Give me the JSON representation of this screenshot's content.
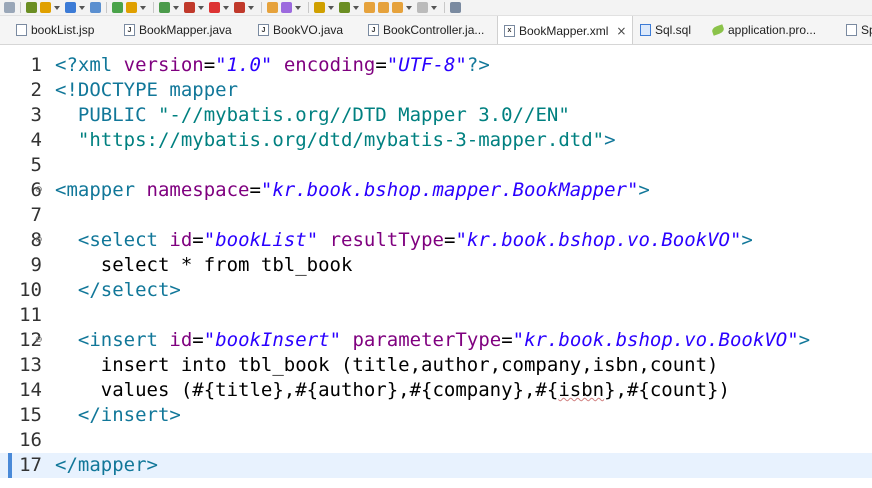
{
  "tabs": [
    {
      "label": "bookList.jsp",
      "icon": "jsp-file-icon",
      "active": false
    },
    {
      "label": "BookMapper.java",
      "icon": "java-file-icon",
      "active": false
    },
    {
      "label": "BookVO.java",
      "icon": "java-file-icon",
      "active": false
    },
    {
      "label": "BookController.ja...",
      "icon": "java-file-icon",
      "active": false
    },
    {
      "label": "BookMapper.xml",
      "icon": "xml-file-icon",
      "active": true,
      "close": "×"
    },
    {
      "label": "Sql.sql",
      "icon": "sql-file-icon",
      "active": false
    },
    {
      "label": "application.pro...",
      "icon": "properties-file-icon",
      "active": false
    },
    {
      "label": "Sp",
      "icon": "file-icon",
      "active": false
    }
  ],
  "editor": {
    "current_line": 17,
    "lines": [
      {
        "n": "1",
        "fold": "",
        "tokens": [
          [
            "tag",
            "<?xml "
          ],
          [
            "attr",
            "version"
          ],
          [
            "kw",
            "="
          ],
          [
            "str",
            "\"1.0\""
          ],
          [
            "kw",
            " "
          ],
          [
            "attr",
            "encoding"
          ],
          [
            "kw",
            "="
          ],
          [
            "str",
            "\"UTF-8\""
          ],
          [
            "tag",
            "?>"
          ]
        ]
      },
      {
        "n": "2",
        "fold": "",
        "tokens": [
          [
            "tag",
            "<!DOCTYPE mapper"
          ]
        ]
      },
      {
        "n": "3",
        "fold": "",
        "tokens": [
          [
            "tag",
            "  PUBLIC "
          ],
          [
            "dtd",
            "\"-//mybatis.org//DTD Mapper 3.0//EN\""
          ]
        ]
      },
      {
        "n": "4",
        "fold": "",
        "tokens": [
          [
            "dtd",
            "  \"https://mybatis.org/dtd/mybatis-3-mapper.dtd\""
          ],
          [
            "tag",
            ">"
          ]
        ]
      },
      {
        "n": "5",
        "fold": "",
        "tokens": []
      },
      {
        "n": "6",
        "fold": "⊖",
        "tokens": [
          [
            "tag",
            "<mapper "
          ],
          [
            "attr",
            "namespace"
          ],
          [
            "kw",
            "="
          ],
          [
            "str",
            "\"kr.book.bshop.mapper.BookMapper\""
          ],
          [
            "tag",
            ">"
          ]
        ]
      },
      {
        "n": "7",
        "fold": "",
        "tokens": []
      },
      {
        "n": "8",
        "fold": "⊖",
        "tokens": [
          [
            "kw",
            "  "
          ],
          [
            "tag",
            "<select "
          ],
          [
            "attr",
            "id"
          ],
          [
            "kw",
            "="
          ],
          [
            "str",
            "\"bookList\""
          ],
          [
            "kw",
            " "
          ],
          [
            "attr",
            "resultType"
          ],
          [
            "kw",
            "="
          ],
          [
            "str",
            "\"kr.book.bshop.vo.BookVO\""
          ],
          [
            "tag",
            ">"
          ]
        ]
      },
      {
        "n": "9",
        "fold": "",
        "tokens": [
          [
            "kw",
            "    select * from tbl_book"
          ]
        ]
      },
      {
        "n": "10",
        "fold": "",
        "tokens": [
          [
            "kw",
            "  "
          ],
          [
            "tag",
            "</select>"
          ]
        ]
      },
      {
        "n": "11",
        "fold": "",
        "tokens": []
      },
      {
        "n": "12",
        "fold": "⊖",
        "tokens": [
          [
            "kw",
            "  "
          ],
          [
            "tag",
            "<insert "
          ],
          [
            "attr",
            "id"
          ],
          [
            "kw",
            "="
          ],
          [
            "str",
            "\"bookInsert\""
          ],
          [
            "kw",
            " "
          ],
          [
            "attr",
            "parameterType"
          ],
          [
            "kw",
            "="
          ],
          [
            "str",
            "\"kr.book.bshop.vo.BookVO\""
          ],
          [
            "tag",
            ">"
          ]
        ]
      },
      {
        "n": "13",
        "fold": "",
        "tokens": [
          [
            "kw",
            "    insert into tbl_book (title,author,company,isbn,count)"
          ]
        ]
      },
      {
        "n": "14",
        "fold": "",
        "tokens": [
          [
            "kw",
            "    values (#{title},#{author},#{company},#{"
          ],
          [
            "sq",
            "isbn"
          ],
          [
            "kw",
            "},#{count})"
          ]
        ]
      },
      {
        "n": "15",
        "fold": "",
        "tokens": [
          [
            "kw",
            "  "
          ],
          [
            "tag",
            "</insert>"
          ]
        ]
      },
      {
        "n": "16",
        "fold": "",
        "tokens": []
      },
      {
        "n": "17",
        "fold": "",
        "tokens": [
          [
            "tag",
            "</mapper>"
          ]
        ]
      }
    ]
  },
  "colors": {
    "tag": "#117799",
    "attribute": "#7f007f",
    "string": "#2a00ff",
    "current_line_bg": "#e8f2fe"
  }
}
